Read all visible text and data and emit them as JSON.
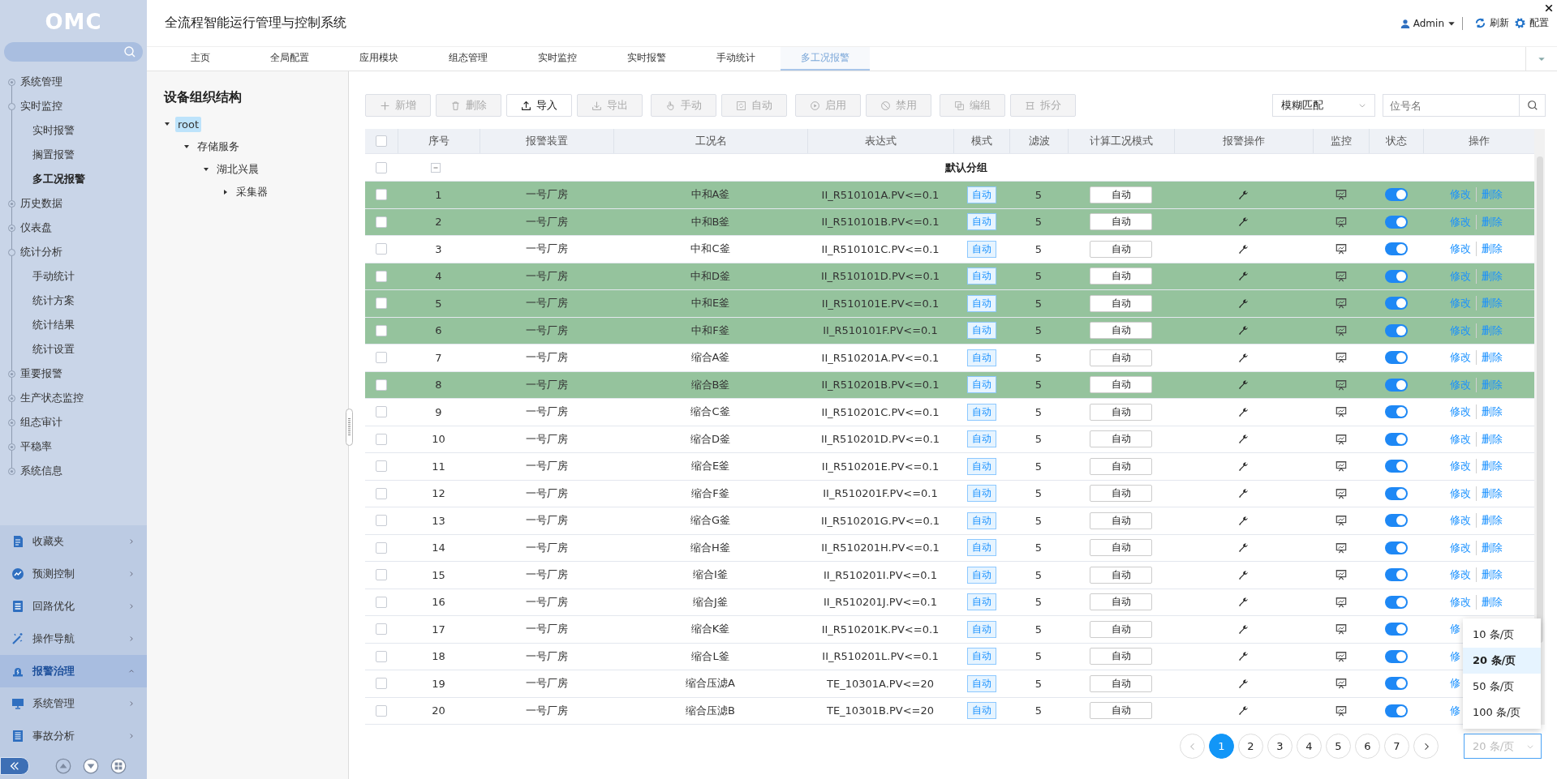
{
  "sidebar": {
    "logo": "OMC",
    "nav": [
      {
        "label": "系统管理",
        "expanded": false,
        "selected": false
      },
      {
        "label": "实时监控",
        "expanded": true,
        "selected": false,
        "children": [
          {
            "label": "实时报警",
            "selected": false
          },
          {
            "label": "搁置报警",
            "selected": false
          },
          {
            "label": "多工况报警",
            "selected": true
          }
        ]
      },
      {
        "label": "历史数据",
        "expanded": false,
        "selected": false
      },
      {
        "label": "仪表盘",
        "expanded": false,
        "selected": false
      },
      {
        "label": "统计分析",
        "expanded": true,
        "selected": false,
        "children": [
          {
            "label": "手动统计",
            "selected": false
          },
          {
            "label": "统计方案",
            "selected": false
          },
          {
            "label": "统计结果",
            "selected": false
          },
          {
            "label": "统计设置",
            "selected": false
          }
        ]
      },
      {
        "label": "重要报警",
        "expanded": false,
        "selected": false
      },
      {
        "label": "生产状态监控",
        "expanded": false,
        "selected": false
      },
      {
        "label": "组态审计",
        "expanded": false,
        "selected": false
      },
      {
        "label": "平稳率",
        "expanded": false,
        "selected": false
      },
      {
        "label": "系统信息",
        "expanded": false,
        "selected": false
      }
    ],
    "modules": [
      {
        "label": "收藏夹",
        "selected": false,
        "expanded": false
      },
      {
        "label": "预测控制",
        "selected": false,
        "expanded": false
      },
      {
        "label": "回路优化",
        "selected": false,
        "expanded": false
      },
      {
        "label": "操作导航",
        "selected": false,
        "expanded": false
      },
      {
        "label": "报警治理",
        "selected": true,
        "expanded": true
      },
      {
        "label": "系统管理",
        "selected": false,
        "expanded": false
      },
      {
        "label": "事故分析",
        "selected": false,
        "expanded": false
      }
    ]
  },
  "header": {
    "title": "全流程智能运行管理与控制系统",
    "user": "Admin",
    "actions": [
      "刷新",
      "配置"
    ]
  },
  "tabs": [
    {
      "label": "主页",
      "selected": false
    },
    {
      "label": "全局配置",
      "selected": false
    },
    {
      "label": "应用模块",
      "selected": false
    },
    {
      "label": "组态管理",
      "selected": false
    },
    {
      "label": "实时监控",
      "selected": false
    },
    {
      "label": "实时报警",
      "selected": false
    },
    {
      "label": "手动统计",
      "selected": false
    },
    {
      "label": "多工况报警",
      "selected": true
    }
  ],
  "tree": {
    "title": "设备组织结构",
    "nodes": [
      {
        "label": "root",
        "selected": true,
        "expanded": true,
        "children": [
          {
            "label": "存储服务",
            "selected": false,
            "expanded": true,
            "children": [
              {
                "label": "湖北兴晨",
                "selected": false,
                "expanded": true,
                "children": [
                  {
                    "label": "采集器",
                    "selected": false,
                    "expanded": false
                  }
                ]
              }
            ]
          }
        ]
      }
    ]
  },
  "toolbar": {
    "buttons": [
      {
        "label": "新增",
        "disabled": true
      },
      {
        "label": "删除",
        "disabled": true
      },
      {
        "label": "导入",
        "disabled": false
      },
      {
        "label": "导出",
        "disabled": true
      },
      {
        "label": "手动",
        "disabled": true
      },
      {
        "label": "自动",
        "disabled": true
      },
      {
        "label": "启用",
        "disabled": true
      },
      {
        "label": "禁用",
        "disabled": true
      },
      {
        "label": "编组",
        "disabled": true
      },
      {
        "label": "拆分",
        "disabled": true
      }
    ],
    "match": {
      "value": "模糊匹配"
    },
    "search": {
      "placeholder": "位号名"
    }
  },
  "table": {
    "header_checked": false,
    "columns": [
      "序号",
      "报警装置",
      "工况名",
      "表达式",
      "模式",
      "滤波",
      "计算工况模式",
      "报警操作",
      "监控",
      "状态",
      "操作"
    ],
    "group": {
      "label": "默认分组",
      "expanded": true,
      "checked": false
    },
    "rows": [
      {
        "seq": "1",
        "device": "一号厂房",
        "name": "中和A釜",
        "expression": "II_R510101A.PV<=0.1",
        "mode": "自动",
        "filter": "5",
        "calc_mode": "自动",
        "on": true,
        "checked": false,
        "selected": true,
        "actions": [
          "修改",
          "删除"
        ]
      },
      {
        "seq": "2",
        "device": "一号厂房",
        "name": "中和B釜",
        "expression": "II_R510101B.PV<=0.1",
        "mode": "自动",
        "filter": "5",
        "calc_mode": "自动",
        "on": true,
        "checked": false,
        "selected": true,
        "actions": [
          "修改",
          "删除"
        ]
      },
      {
        "seq": "3",
        "device": "一号厂房",
        "name": "中和C釜",
        "expression": "II_R510101C.PV<=0.1",
        "mode": "自动",
        "filter": "5",
        "calc_mode": "自动",
        "on": true,
        "checked": false,
        "selected": false,
        "actions": [
          "修改",
          "删除"
        ]
      },
      {
        "seq": "4",
        "device": "一号厂房",
        "name": "中和D釜",
        "expression": "II_R510101D.PV<=0.1",
        "mode": "自动",
        "filter": "5",
        "calc_mode": "自动",
        "on": true,
        "checked": false,
        "selected": true,
        "actions": [
          "修改",
          "删除"
        ]
      },
      {
        "seq": "5",
        "device": "一号厂房",
        "name": "中和E釜",
        "expression": "II_R510101E.PV<=0.1",
        "mode": "自动",
        "filter": "5",
        "calc_mode": "自动",
        "on": true,
        "checked": false,
        "selected": true,
        "actions": [
          "修改",
          "删除"
        ]
      },
      {
        "seq": "6",
        "device": "一号厂房",
        "name": "中和F釜",
        "expression": "II_R510101F.PV<=0.1",
        "mode": "自动",
        "filter": "5",
        "calc_mode": "自动",
        "on": true,
        "checked": false,
        "selected": true,
        "actions": [
          "修改",
          "删除"
        ]
      },
      {
        "seq": "7",
        "device": "一号厂房",
        "name": "缩合A釜",
        "expression": "II_R510201A.PV<=0.1",
        "mode": "自动",
        "filter": "5",
        "calc_mode": "自动",
        "on": true,
        "checked": false,
        "selected": false,
        "actions": [
          "修改",
          "删除"
        ]
      },
      {
        "seq": "8",
        "device": "一号厂房",
        "name": "缩合B釜",
        "expression": "II_R510201B.PV<=0.1",
        "mode": "自动",
        "filter": "5",
        "calc_mode": "自动",
        "on": true,
        "checked": false,
        "selected": true,
        "actions": [
          "修改",
          "删除"
        ]
      },
      {
        "seq": "9",
        "device": "一号厂房",
        "name": "缩合C釜",
        "expression": "II_R510201C.PV<=0.1",
        "mode": "自动",
        "filter": "5",
        "calc_mode": "自动",
        "on": true,
        "checked": false,
        "selected": false,
        "actions": [
          "修改",
          "删除"
        ]
      },
      {
        "seq": "10",
        "device": "一号厂房",
        "name": "缩合D釜",
        "expression": "II_R510201D.PV<=0.1",
        "mode": "自动",
        "filter": "5",
        "calc_mode": "自动",
        "on": true,
        "checked": false,
        "selected": false,
        "actions": [
          "修改",
          "删除"
        ]
      },
      {
        "seq": "11",
        "device": "一号厂房",
        "name": "缩合E釜",
        "expression": "II_R510201E.PV<=0.1",
        "mode": "自动",
        "filter": "5",
        "calc_mode": "自动",
        "on": true,
        "checked": false,
        "selected": false,
        "actions": [
          "修改",
          "删除"
        ]
      },
      {
        "seq": "12",
        "device": "一号厂房",
        "name": "缩合F釜",
        "expression": "II_R510201F.PV<=0.1",
        "mode": "自动",
        "filter": "5",
        "calc_mode": "自动",
        "on": true,
        "checked": false,
        "selected": false,
        "actions": [
          "修改",
          "删除"
        ]
      },
      {
        "seq": "13",
        "device": "一号厂房",
        "name": "缩合G釜",
        "expression": "II_R510201G.PV<=0.1",
        "mode": "自动",
        "filter": "5",
        "calc_mode": "自动",
        "on": true,
        "checked": false,
        "selected": false,
        "actions": [
          "修改",
          "删除"
        ]
      },
      {
        "seq": "14",
        "device": "一号厂房",
        "name": "缩合H釜",
        "expression": "II_R510201H.PV<=0.1",
        "mode": "自动",
        "filter": "5",
        "calc_mode": "自动",
        "on": true,
        "checked": false,
        "selected": false,
        "actions": [
          "修改",
          "删除"
        ]
      },
      {
        "seq": "15",
        "device": "一号厂房",
        "name": "缩合I釜",
        "expression": "II_R510201I.PV<=0.1",
        "mode": "自动",
        "filter": "5",
        "calc_mode": "自动",
        "on": true,
        "checked": false,
        "selected": false,
        "actions": [
          "修改",
          "删除"
        ]
      },
      {
        "seq": "16",
        "device": "一号厂房",
        "name": "缩合J釜",
        "expression": "II_R510201J.PV<=0.1",
        "mode": "自动",
        "filter": "5",
        "calc_mode": "自动",
        "on": true,
        "checked": false,
        "selected": false,
        "actions": [
          "修改",
          "删除"
        ]
      },
      {
        "seq": "17",
        "device": "一号厂房",
        "name": "缩合K釜",
        "expression": "II_R510201K.PV<=0.1",
        "mode": "自动",
        "filter": "5",
        "calc_mode": "自动",
        "on": true,
        "checked": false,
        "selected": false,
        "actions": [
          "修"
        ]
      },
      {
        "seq": "18",
        "device": "一号厂房",
        "name": "缩合L釜",
        "expression": "II_R510201L.PV<=0.1",
        "mode": "自动",
        "filter": "5",
        "calc_mode": "自动",
        "on": true,
        "checked": false,
        "selected": false,
        "actions": [
          "修"
        ]
      },
      {
        "seq": "19",
        "device": "一号厂房",
        "name": "缩合压滤A",
        "expression": "TE_10301A.PV<=20",
        "mode": "自动",
        "filter": "5",
        "calc_mode": "自动",
        "on": true,
        "checked": false,
        "selected": false,
        "actions": [
          "修"
        ]
      },
      {
        "seq": "20",
        "device": "一号厂房",
        "name": "缩合压滤B",
        "expression": "TE_10301B.PV<=20",
        "mode": "自动",
        "filter": "5",
        "calc_mode": "自动",
        "on": true,
        "checked": false,
        "selected": false,
        "actions": [
          "修"
        ]
      }
    ]
  },
  "pagination": {
    "pages": [
      {
        "label": "1",
        "selected": true
      },
      {
        "label": "2",
        "selected": false
      },
      {
        "label": "3",
        "selected": false
      },
      {
        "label": "4",
        "selected": false
      },
      {
        "label": "5",
        "selected": false
      },
      {
        "label": "6",
        "selected": false
      },
      {
        "label": "7",
        "selected": false
      }
    ],
    "page_size": {
      "value": "20 条/页"
    },
    "page_size_options": [
      {
        "label": "10 条/页",
        "selected": false
      },
      {
        "label": "20 条/页",
        "selected": true
      },
      {
        "label": "50 条/页",
        "selected": false
      },
      {
        "label": "100 条/页",
        "selected": false
      }
    ]
  }
}
